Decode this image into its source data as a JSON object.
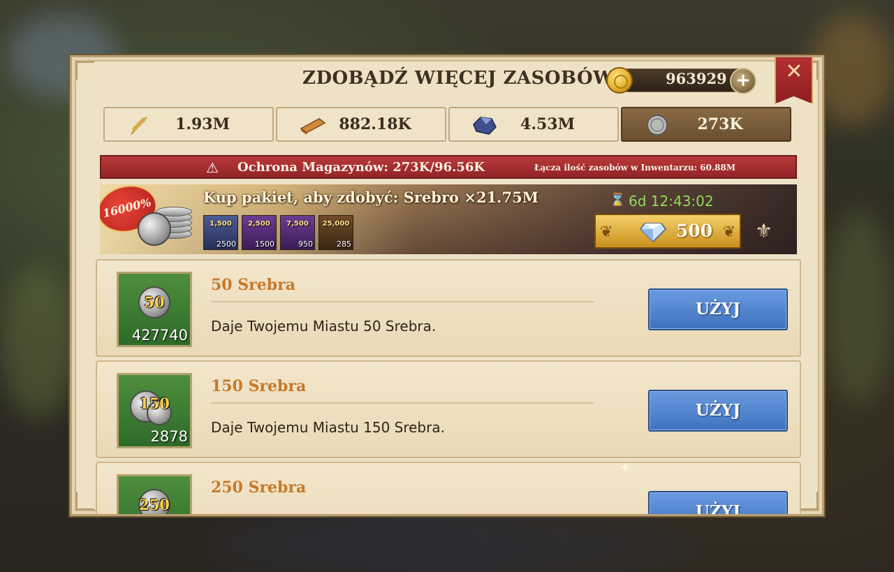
{
  "header": {
    "title": "ZDOBĄDŹ WIĘCEJ ZASOBÓW",
    "gold_value": "963929",
    "plus_label": "+",
    "close_label": "✕"
  },
  "resources": [
    {
      "name": "food",
      "icon": "wheat-icon",
      "value": "1.93M",
      "active": false
    },
    {
      "name": "wood",
      "icon": "wood-plank-icon",
      "value": "882.18K",
      "active": false
    },
    {
      "name": "stone",
      "icon": "stone-ore-icon",
      "value": "4.53M",
      "active": false
    },
    {
      "name": "silver",
      "icon": "silver-coin-icon",
      "value": "273K",
      "active": true
    }
  ],
  "warning": {
    "icon": "⚠",
    "text": "Ochrona Magazynów: 273K/96.56K",
    "sub": "Łącza ilość zasobów w Inwentarzu: 60.88M"
  },
  "promo": {
    "badge": "16000%",
    "title": "Kup pakiet, aby zdobyć: Srebro ×21.75M",
    "packs": [
      {
        "label": "1,500",
        "count": "2500",
        "color": "#3d4a7a"
      },
      {
        "label": "2,500",
        "count": "1500",
        "color": "#5a2f78"
      },
      {
        "label": "7,500",
        "count": "950",
        "color": "#5a2f78"
      },
      {
        "label": "25,000",
        "count": "285",
        "color": "#5a3a1e"
      }
    ],
    "timer_icon": "⌛",
    "timer": "6d 12:43:02",
    "price": "500",
    "deco_left": "❦",
    "deco_right": "❦",
    "fleur": "⚜"
  },
  "items": [
    {
      "badge": "50",
      "qty": "427740",
      "name": "50 Srebra",
      "desc": "Daje Twojemu Miastu 50 Srebra.",
      "button": "UŻYJ"
    },
    {
      "badge": "150",
      "qty": "2878",
      "name": "150 Srebra",
      "desc": "Daje Twojemu Miastu 150 Srebra.",
      "button": "UŻYJ"
    },
    {
      "badge": "250",
      "qty": "",
      "name": "250 Srebra",
      "desc": "",
      "button": "UŻYJ"
    }
  ],
  "sparkle": "✦"
}
